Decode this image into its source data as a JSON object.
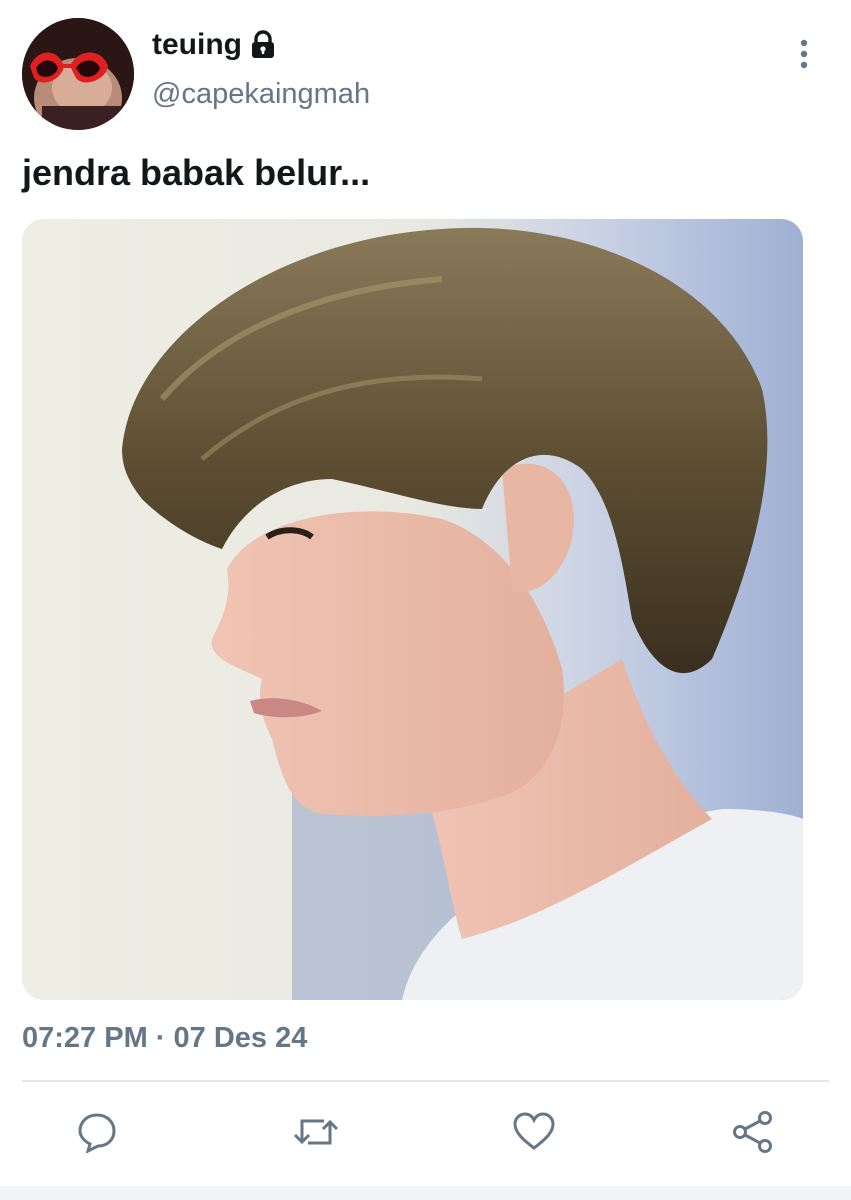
{
  "user": {
    "display_name": "teuing",
    "handle": "@capekaingmah",
    "protected_icon": "lock-icon",
    "avatar": "avatar-photo"
  },
  "tweet": {
    "text": "jendra babak belur...",
    "timestamp": "07:27 PM · 07 Des 24",
    "media": "photo"
  },
  "menu": {
    "icon": "more-vertical-icon"
  },
  "actions": [
    {
      "icon": "reply-icon"
    },
    {
      "icon": "retweet-icon"
    },
    {
      "icon": "like-icon"
    },
    {
      "icon": "share-icon"
    }
  ],
  "colors": {
    "text_primary": "#14171a",
    "text_secondary": "#657786",
    "divider": "#e1e8ed"
  }
}
